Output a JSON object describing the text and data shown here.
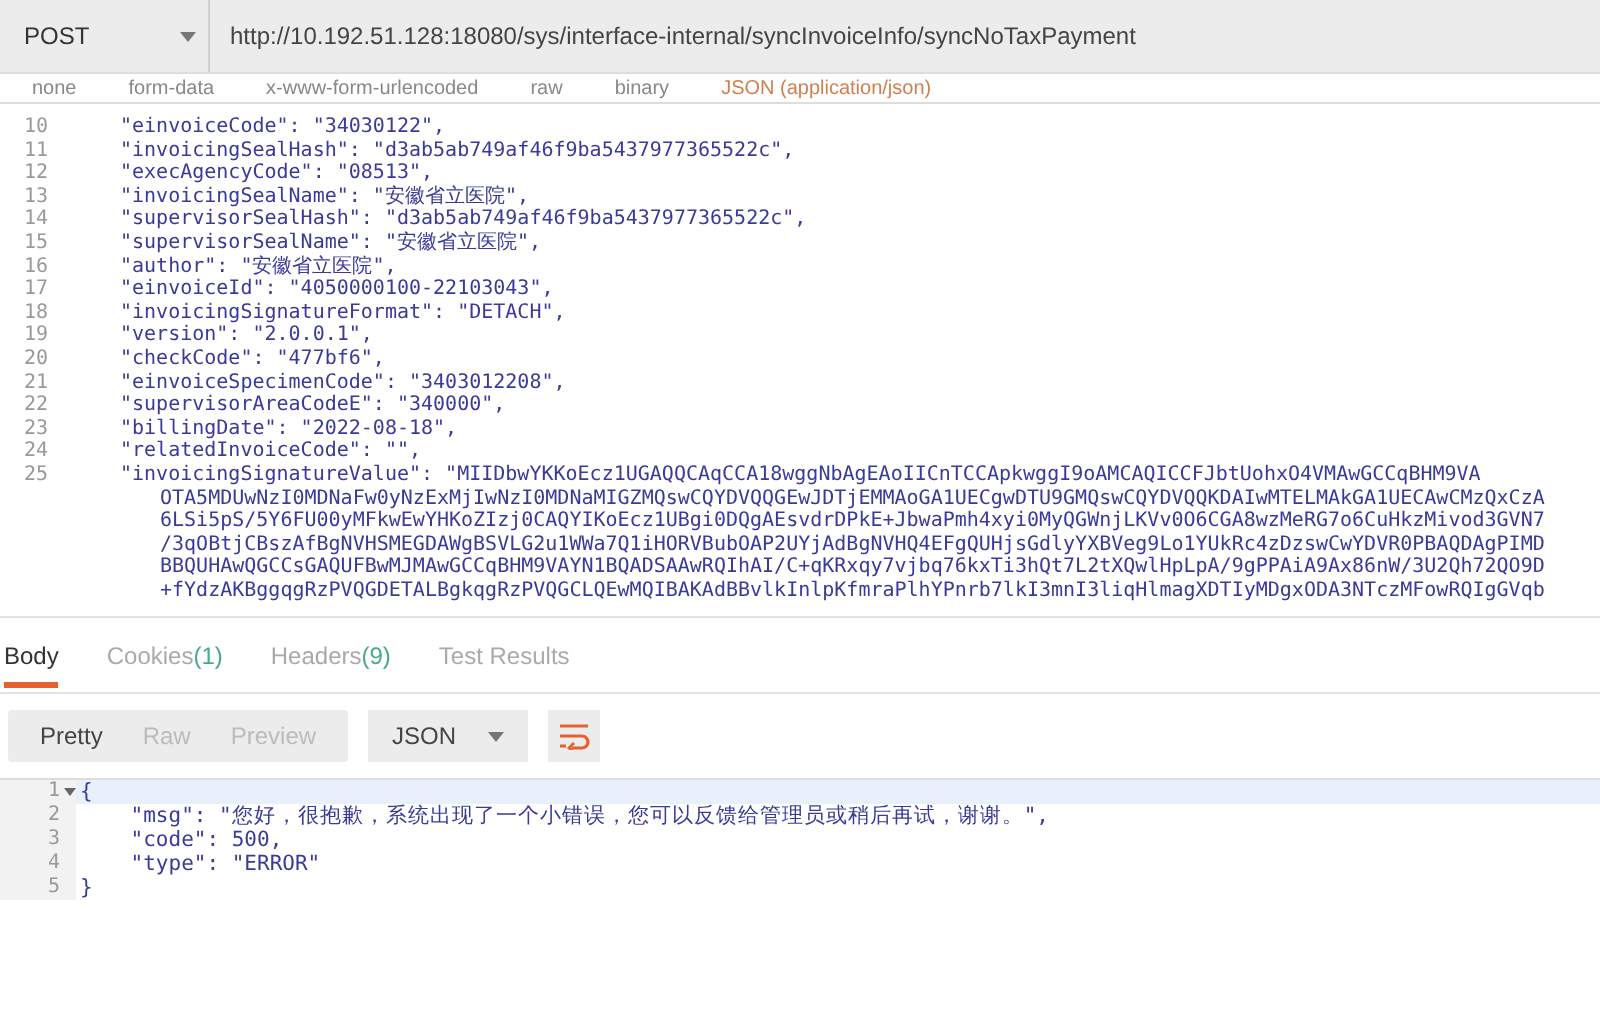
{
  "request": {
    "method": "POST",
    "url": "http://10.192.51.128:18080/sys/interface-internal/syncInvoiceInfo/syncNoTaxPayment"
  },
  "body_types": [
    "none",
    "form-data",
    "x-www-form-urlencoded",
    "raw",
    "binary"
  ],
  "content_type": "JSON (application/json)",
  "request_body": [
    {
      "number": "10",
      "text": "\"einvoiceCode\": \"34030122\","
    },
    {
      "number": "11",
      "text": "\"invoicingSealHash\": \"d3ab5ab749af46f9ba5437977365522c\","
    },
    {
      "number": "12",
      "text": "\"execAgencyCode\": \"08513\","
    },
    {
      "number": "13",
      "text": "\"invoicingSealName\": \"安徽省立医院\","
    },
    {
      "number": "14",
      "text": "\"supervisorSealHash\": \"d3ab5ab749af46f9ba5437977365522c\","
    },
    {
      "number": "15",
      "text": "\"supervisorSealName\": \"安徽省立医院\","
    },
    {
      "number": "16",
      "text": "\"author\": \"安徽省立医院\","
    },
    {
      "number": "17",
      "text": "\"einvoiceId\": \"4050000100-22103043\","
    },
    {
      "number": "18",
      "text": "\"invoicingSignatureFormat\": \"DETACH\","
    },
    {
      "number": "19",
      "text": "\"version\": \"2.0.0.1\","
    },
    {
      "number": "20",
      "text": "\"checkCode\": \"477bf6\","
    },
    {
      "number": "21",
      "text": "\"einvoiceSpecimenCode\": \"3403012208\","
    },
    {
      "number": "22",
      "text": "\"supervisorAreaCodeE\": \"340000\","
    },
    {
      "number": "23",
      "text": "\"billingDate\": \"2022-08-18\","
    },
    {
      "number": "24",
      "text": "\"relatedInvoiceCode\": \"\","
    },
    {
      "number": "25",
      "text": "\"invoicingSignatureValue\": \"MIIDbwYKKoEcz1UGAQQCAqCCA18wggNbAgEAoIICnTCCApkwggI9oAMCAQICCFJbtUohxO4VMAwGCCqBHM9VA"
    },
    {
      "text": "OTA5MDUwNzI0MDNaFw0yNzExMjIwNzI0MDNaMIGZMQswCQYDVQQGEwJDTjEMMAoGA1UECgwDTU9GMQswCQYDVQQKDAIwMTELMAkGA1UECAwCMzQxCzA"
    },
    {
      "text": "6LSi5pS/5Y6FU00yMFkwEwYHKoZIzj0CAQYIKoEcz1UBgi0DQgAEsvdrDPkE+JbwaPmh4xyi0MyQGWnjLKVv0O6CGA8wzMeRG7o6CuHkzMivod3GVN7"
    },
    {
      "text": "/3qOBtjCBszAfBgNVHSMEGDAWgBSVLG2u1WWa7Q1iHORVBubOAP2UYjAdBgNVHQ4EFgQUHjsGdlyYXBVeg9Lo1YUkRc4zDzswCwYDVR0PBAQDAgPIMD"
    },
    {
      "text": "BBQUHAwQGCCsGAQUFBwMJMAwGCCqBHM9VAYN1BQADSAAwRQIhAI/C+qKRxqy7vjbq76kxTi3hQt7L2tXQwlHpLpA/9gPPAiA9Ax86nW/3U2Qh72QO9D"
    },
    {
      "text": "+fYdzAKBggqgRzPVQGDETALBgkqgRzPVQGCLQEwMQIBAKAdBBvlkInlpKfmraPlhYPnrb7lkI3mnI3liqHlmagXDTIyMDgxODA3NTczMFowRQIgGVqb"
    }
  ],
  "response": {
    "tabs": [
      {
        "label": "Body",
        "selected": true
      },
      {
        "label": "Cookies",
        "count": "(1)",
        "selected": false
      },
      {
        "label": "Headers",
        "count": "(9)",
        "selected": false
      },
      {
        "label": "Test Results",
        "selected": false
      }
    ],
    "view_modes": [
      {
        "label": "Pretty",
        "selected": true
      },
      {
        "label": "Raw",
        "selected": false
      },
      {
        "label": "Preview",
        "selected": false
      }
    ],
    "format": "JSON",
    "lines": [
      {
        "number": "1",
        "text": "{",
        "fold": true,
        "highlighted": true
      },
      {
        "number": "2",
        "text": "    \"msg\": \"您好，很抱歉，系统出现了一个小错误，您可以反馈给管理员或稍后再试，谢谢。\",",
        "fold": false,
        "highlighted": false
      },
      {
        "number": "3",
        "text": "    \"code\": 500,",
        "fold": false,
        "highlighted": false
      },
      {
        "number": "4",
        "text": "    \"type\": \"ERROR\"",
        "fold": false,
        "highlighted": false
      },
      {
        "number": "5",
        "text": "}",
        "fold": false,
        "highlighted": false
      }
    ]
  }
}
